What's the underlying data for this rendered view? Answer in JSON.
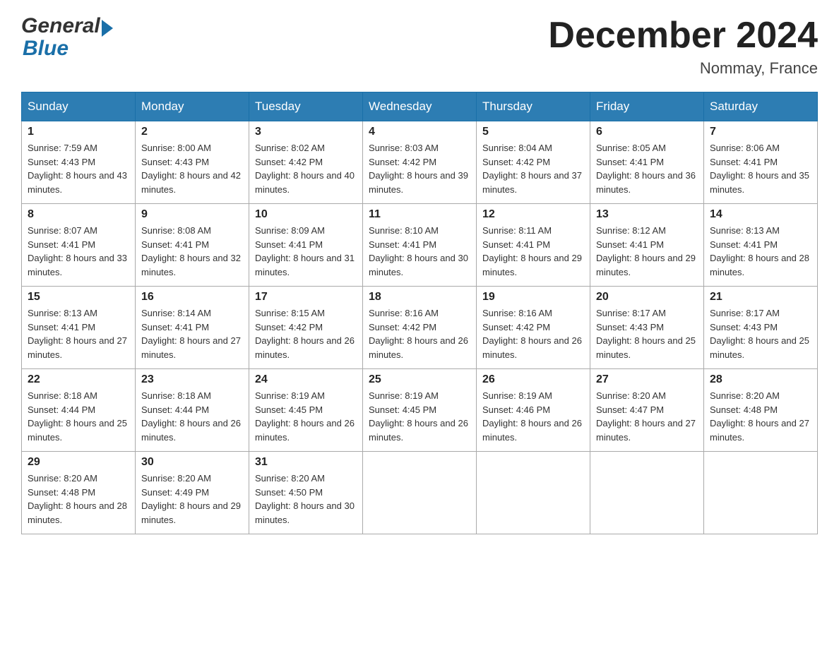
{
  "header": {
    "logo_general": "General",
    "logo_blue": "Blue",
    "month_title": "December 2024",
    "location": "Nommay, France"
  },
  "days_of_week": [
    "Sunday",
    "Monday",
    "Tuesday",
    "Wednesday",
    "Thursday",
    "Friday",
    "Saturday"
  ],
  "weeks": [
    [
      {
        "day": "1",
        "sunrise": "7:59 AM",
        "sunset": "4:43 PM",
        "daylight": "8 hours and 43 minutes."
      },
      {
        "day": "2",
        "sunrise": "8:00 AM",
        "sunset": "4:43 PM",
        "daylight": "8 hours and 42 minutes."
      },
      {
        "day": "3",
        "sunrise": "8:02 AM",
        "sunset": "4:42 PM",
        "daylight": "8 hours and 40 minutes."
      },
      {
        "day": "4",
        "sunrise": "8:03 AM",
        "sunset": "4:42 PM",
        "daylight": "8 hours and 39 minutes."
      },
      {
        "day": "5",
        "sunrise": "8:04 AM",
        "sunset": "4:42 PM",
        "daylight": "8 hours and 37 minutes."
      },
      {
        "day": "6",
        "sunrise": "8:05 AM",
        "sunset": "4:41 PM",
        "daylight": "8 hours and 36 minutes."
      },
      {
        "day": "7",
        "sunrise": "8:06 AM",
        "sunset": "4:41 PM",
        "daylight": "8 hours and 35 minutes."
      }
    ],
    [
      {
        "day": "8",
        "sunrise": "8:07 AM",
        "sunset": "4:41 PM",
        "daylight": "8 hours and 33 minutes."
      },
      {
        "day": "9",
        "sunrise": "8:08 AM",
        "sunset": "4:41 PM",
        "daylight": "8 hours and 32 minutes."
      },
      {
        "day": "10",
        "sunrise": "8:09 AM",
        "sunset": "4:41 PM",
        "daylight": "8 hours and 31 minutes."
      },
      {
        "day": "11",
        "sunrise": "8:10 AM",
        "sunset": "4:41 PM",
        "daylight": "8 hours and 30 minutes."
      },
      {
        "day": "12",
        "sunrise": "8:11 AM",
        "sunset": "4:41 PM",
        "daylight": "8 hours and 29 minutes."
      },
      {
        "day": "13",
        "sunrise": "8:12 AM",
        "sunset": "4:41 PM",
        "daylight": "8 hours and 29 minutes."
      },
      {
        "day": "14",
        "sunrise": "8:13 AM",
        "sunset": "4:41 PM",
        "daylight": "8 hours and 28 minutes."
      }
    ],
    [
      {
        "day": "15",
        "sunrise": "8:13 AM",
        "sunset": "4:41 PM",
        "daylight": "8 hours and 27 minutes."
      },
      {
        "day": "16",
        "sunrise": "8:14 AM",
        "sunset": "4:41 PM",
        "daylight": "8 hours and 27 minutes."
      },
      {
        "day": "17",
        "sunrise": "8:15 AM",
        "sunset": "4:42 PM",
        "daylight": "8 hours and 26 minutes."
      },
      {
        "day": "18",
        "sunrise": "8:16 AM",
        "sunset": "4:42 PM",
        "daylight": "8 hours and 26 minutes."
      },
      {
        "day": "19",
        "sunrise": "8:16 AM",
        "sunset": "4:42 PM",
        "daylight": "8 hours and 26 minutes."
      },
      {
        "day": "20",
        "sunrise": "8:17 AM",
        "sunset": "4:43 PM",
        "daylight": "8 hours and 25 minutes."
      },
      {
        "day": "21",
        "sunrise": "8:17 AM",
        "sunset": "4:43 PM",
        "daylight": "8 hours and 25 minutes."
      }
    ],
    [
      {
        "day": "22",
        "sunrise": "8:18 AM",
        "sunset": "4:44 PM",
        "daylight": "8 hours and 25 minutes."
      },
      {
        "day": "23",
        "sunrise": "8:18 AM",
        "sunset": "4:44 PM",
        "daylight": "8 hours and 26 minutes."
      },
      {
        "day": "24",
        "sunrise": "8:19 AM",
        "sunset": "4:45 PM",
        "daylight": "8 hours and 26 minutes."
      },
      {
        "day": "25",
        "sunrise": "8:19 AM",
        "sunset": "4:45 PM",
        "daylight": "8 hours and 26 minutes."
      },
      {
        "day": "26",
        "sunrise": "8:19 AM",
        "sunset": "4:46 PM",
        "daylight": "8 hours and 26 minutes."
      },
      {
        "day": "27",
        "sunrise": "8:20 AM",
        "sunset": "4:47 PM",
        "daylight": "8 hours and 27 minutes."
      },
      {
        "day": "28",
        "sunrise": "8:20 AM",
        "sunset": "4:48 PM",
        "daylight": "8 hours and 27 minutes."
      }
    ],
    [
      {
        "day": "29",
        "sunrise": "8:20 AM",
        "sunset": "4:48 PM",
        "daylight": "8 hours and 28 minutes."
      },
      {
        "day": "30",
        "sunrise": "8:20 AM",
        "sunset": "4:49 PM",
        "daylight": "8 hours and 29 minutes."
      },
      {
        "day": "31",
        "sunrise": "8:20 AM",
        "sunset": "4:50 PM",
        "daylight": "8 hours and 30 minutes."
      },
      null,
      null,
      null,
      null
    ]
  ],
  "labels": {
    "sunrise": "Sunrise:",
    "sunset": "Sunset:",
    "daylight": "Daylight:"
  }
}
